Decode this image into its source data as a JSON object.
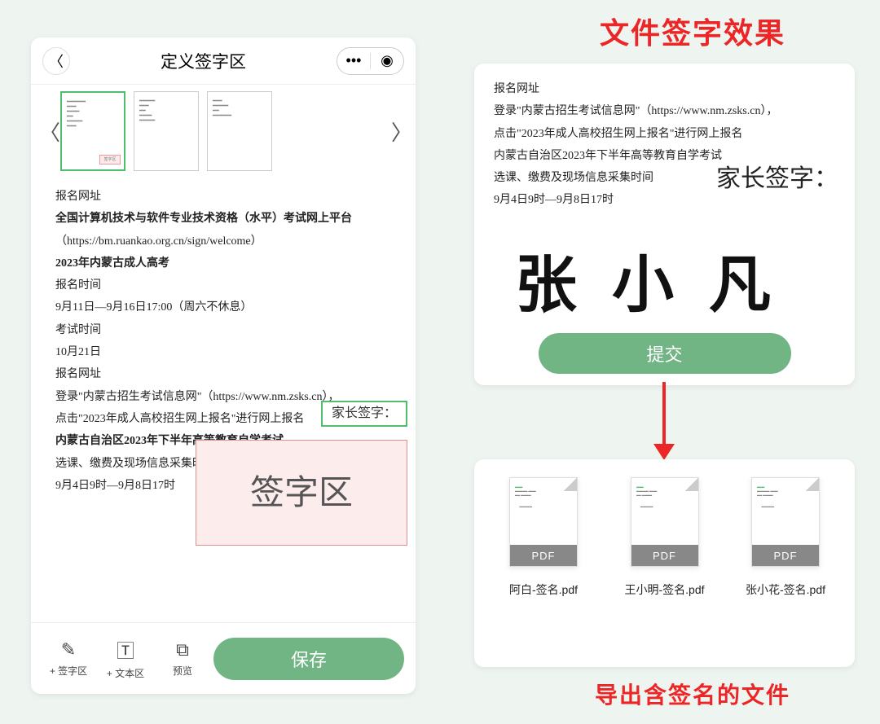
{
  "phone": {
    "title": "定义签字区",
    "thumbs": {
      "sig_mark": "签字区"
    },
    "doc": {
      "l1": "报名网址",
      "l2": "全国计算机技术与软件专业技术资格（水平）考试网上平台",
      "l3": "（https://bm.ruankao.org.cn/sign/welcome）",
      "l4": "2023年内蒙古成人高考",
      "l5": "报名时间",
      "l6": "9月11日—9月16日17:00（周六不休息）",
      "l7": "考试时间",
      "l8": "10月21日",
      "l9": "报名网址",
      "l10": "登录\"内蒙古招生考试信息网\"（https://www.nm.zsks.cn），",
      "l11": "点击\"2023年成人高校招生网上报名\"进行网上报名",
      "l12": "内蒙古自治区2023年下半年高等教育自学考试",
      "l13": "选课、缴费及现场信息采集时间",
      "l14": "9月4日9时—9月8日17时"
    },
    "parent_sign_label": "家长签字：",
    "sig_area_text": "签字区",
    "tool_sign": "+ 签字区",
    "tool_text": "+ 文本区",
    "tool_preview": "预览",
    "save": "保存"
  },
  "right": {
    "title": "文件签字效果",
    "doc": {
      "l1": "报名网址",
      "l2": "登录\"内蒙古招生考试信息网\"（https://www.nm.zsks.cn），",
      "l3": "点击\"2023年成人高校招生网上报名\"进行网上报名",
      "l4": "内蒙古自治区2023年下半年高等教育自学考试",
      "l5": "选课、缴费及现场信息采集时间",
      "l6": "9月4日9时—9月8日17时"
    },
    "parent_sign_label": "家长签字：",
    "signature": "张 小 凡",
    "submit": "提交",
    "files": [
      {
        "name": "阿白-签名.pdf"
      },
      {
        "name": "王小明-签名.pdf"
      },
      {
        "name": "张小花-签名.pdf"
      }
    ],
    "pdf_band": "PDF",
    "export_caption": "导出含签名的文件"
  }
}
